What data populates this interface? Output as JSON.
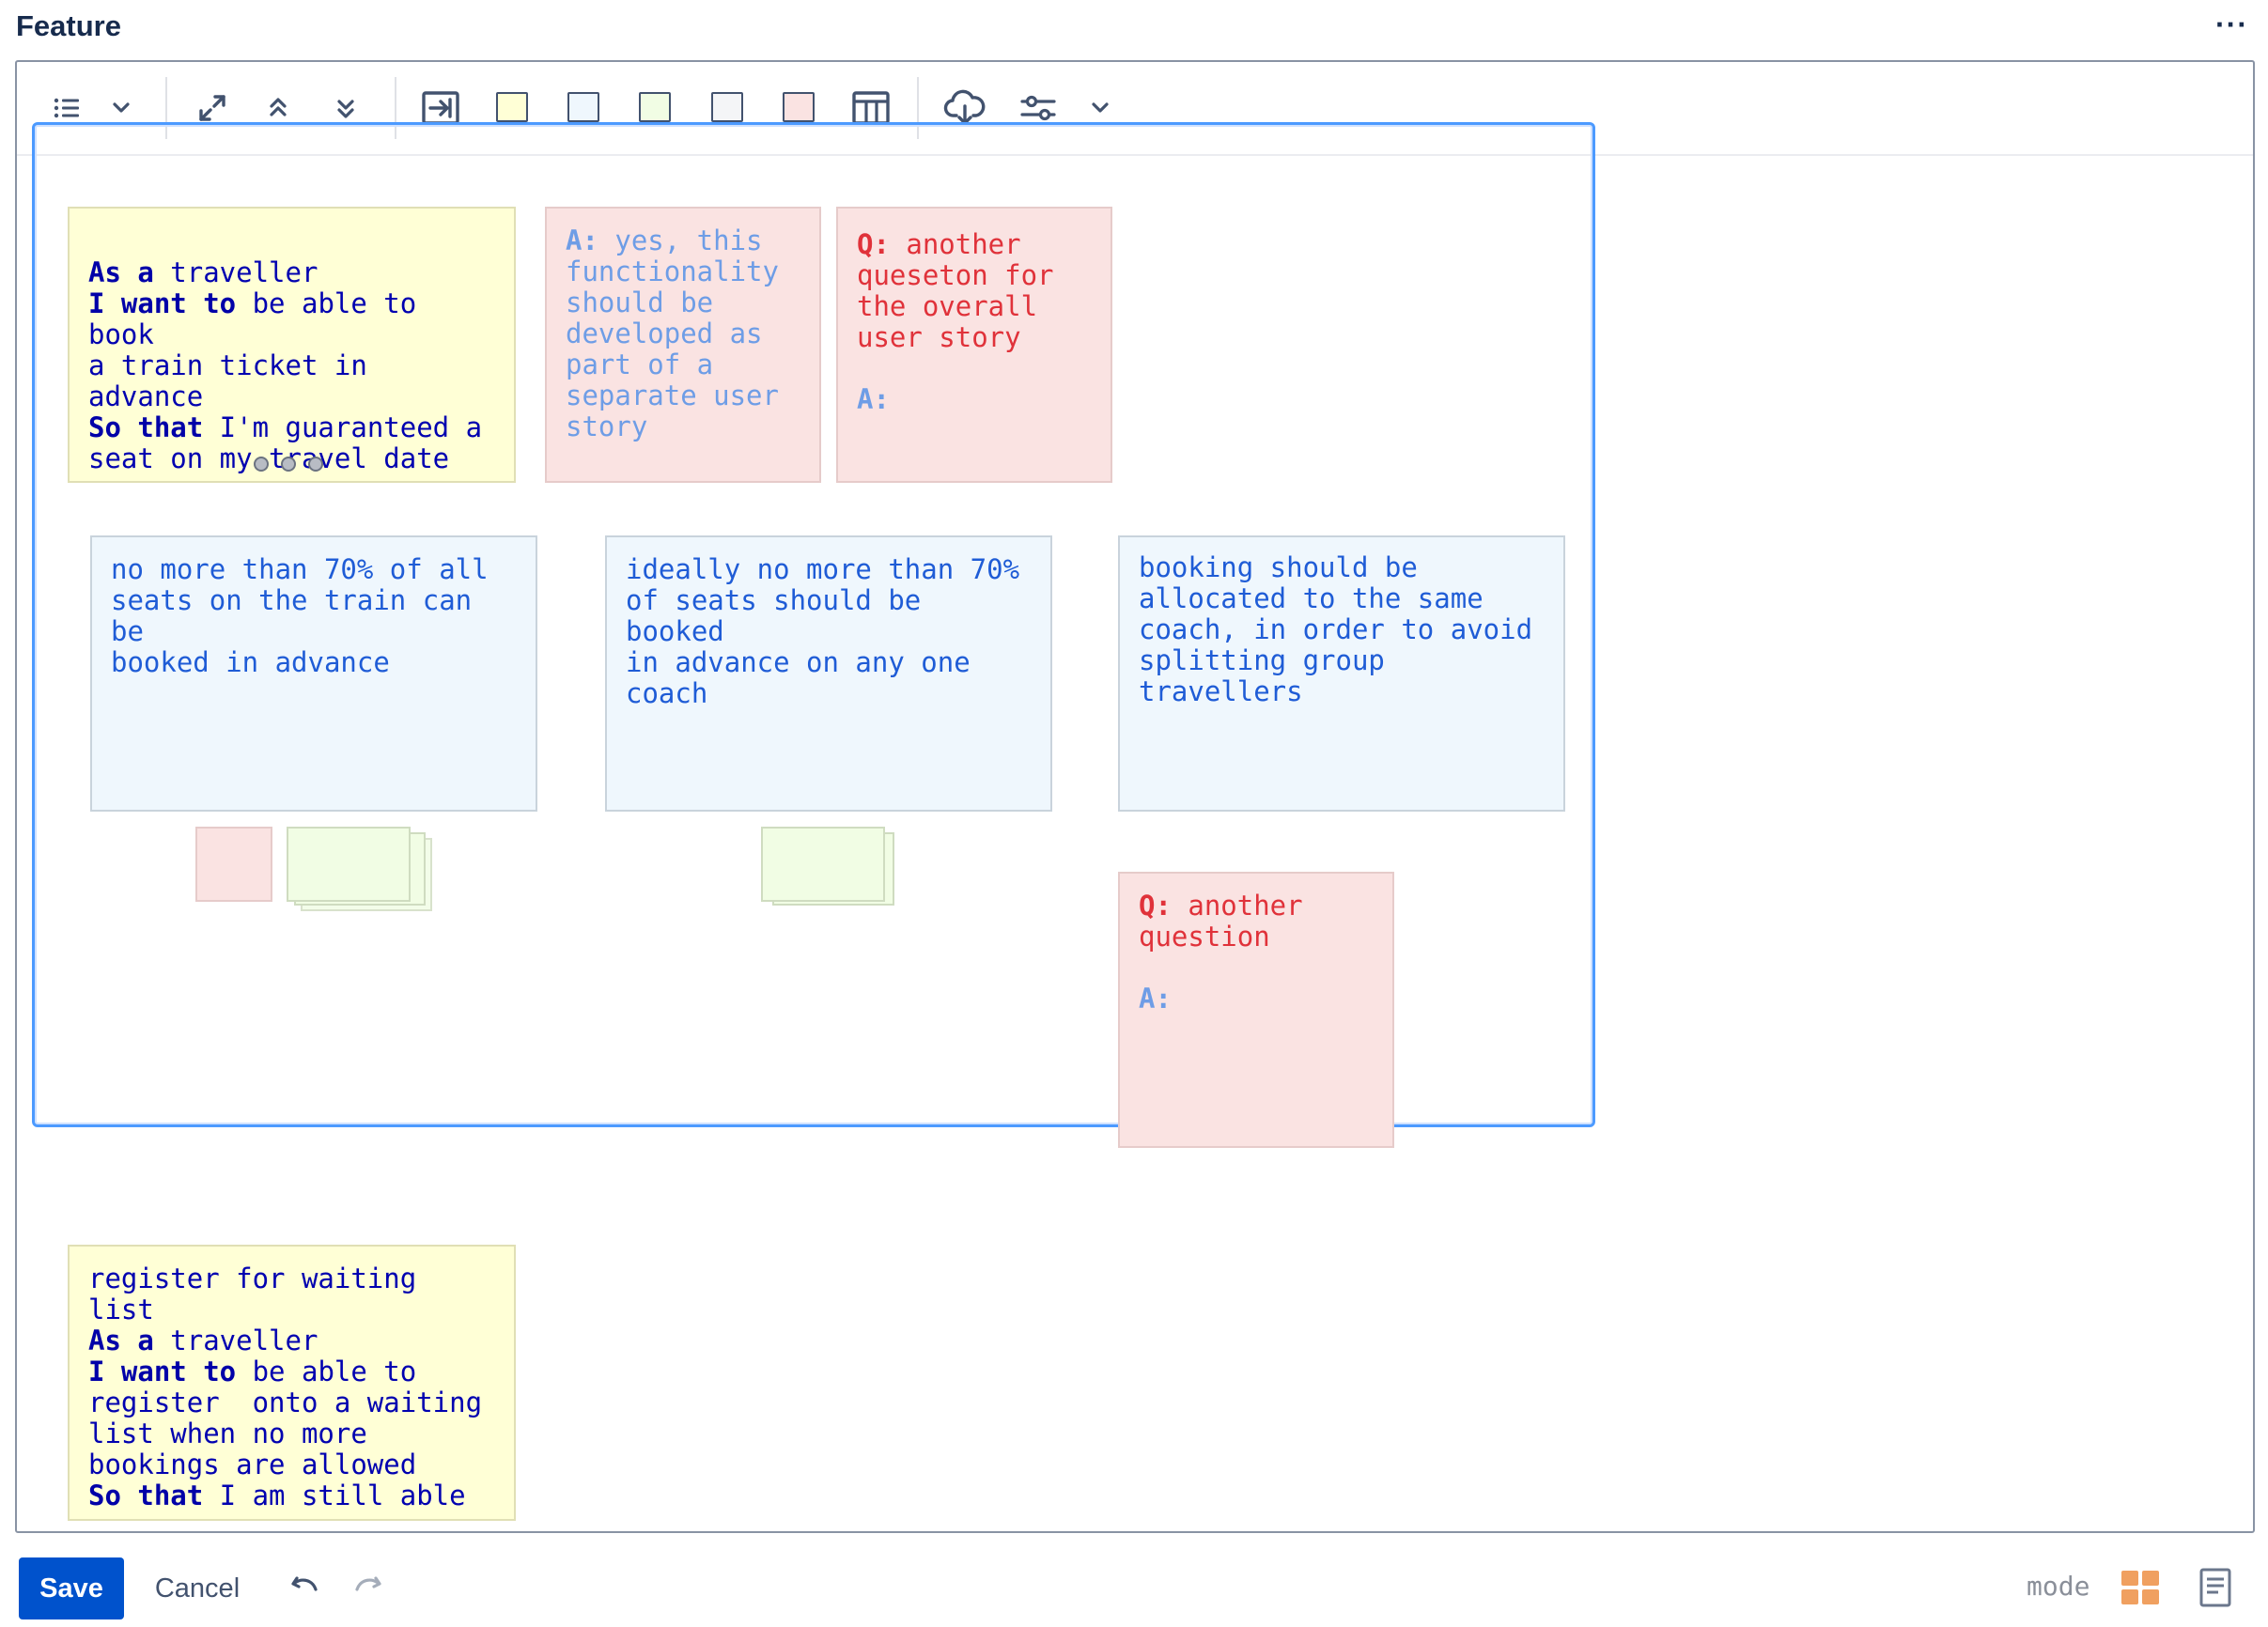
{
  "page": {
    "title": "Feature",
    "more_label": "···"
  },
  "toolbar": {
    "icons": [
      "list-icon",
      "chevron-down-icon",
      "expand-icon",
      "collapse-up-icon",
      "expand-down-icon",
      "insert-icon",
      "table-icon",
      "cloud-download-icon",
      "sliders-icon",
      "chevron-down-icon"
    ],
    "swatch_colors": {
      "yellow": "#ffffd6",
      "blue": "#eff7fd",
      "green": "#f1fde4",
      "grey": "#f4f5f7",
      "pink": "#fae3e2"
    }
  },
  "board": {
    "story1": {
      "l1_kw": "As a",
      "l1": " traveller",
      "l2_kw": "I want to",
      "l2": " be able to book\na train ticket in advance",
      "l3_kw": "So that",
      "l3": " I'm guaranteed a\nseat on my travel date"
    },
    "answer1": {
      "prefix": "A:",
      "text": " yes, this\nfunctionality\nshould be\ndeveloped as\npart of a\nseparate user\nstory"
    },
    "question1": {
      "prefix": "Q:",
      "text": " another\nqueseton for\nthe overall\nuser story",
      "answer_prefix": "A:"
    },
    "rule1": "no more than 70% of all\nseats on the train can be\nbooked in advance",
    "rule2": "ideally no more than 70%\nof seats should be booked\nin advance on any one\ncoach",
    "rule3": "booking should be\nallocated to the same\ncoach, in order to avoid\nsplitting group\ntravellers",
    "question2": {
      "prefix": "Q:",
      "text": " another\nquestion",
      "answer_prefix": "A:"
    },
    "story2": {
      "l0": "register for waiting list",
      "l1_kw": "As a",
      "l1": " traveller",
      "l2_kw": "I want to",
      "l2": " be able to\nregister  onto a waiting\nlist when no more\nbookings are allowed",
      "l3_kw": "So that",
      "l3": " I am still able"
    }
  },
  "footer": {
    "save_label": "Save",
    "cancel_label": "Cancel",
    "mode_label": "mode"
  }
}
